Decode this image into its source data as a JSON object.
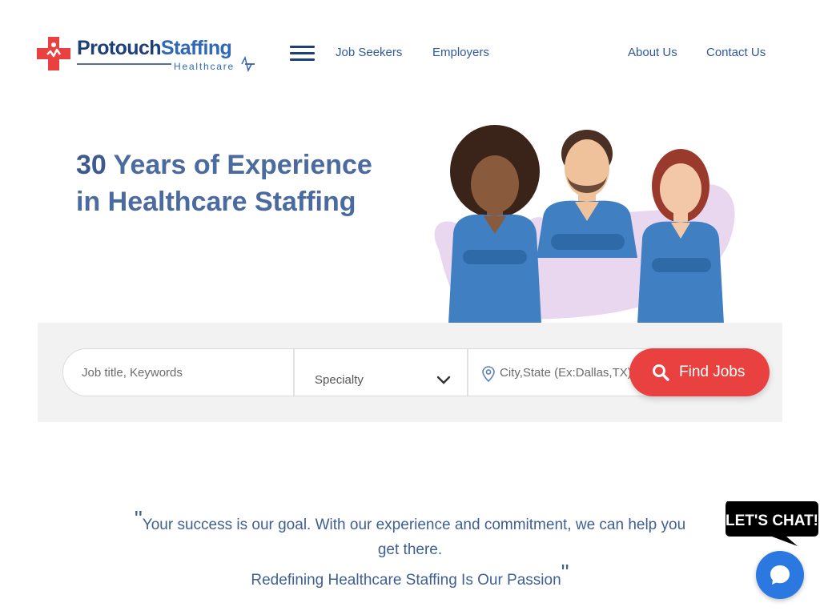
{
  "logo": {
    "word1": "Protouch",
    "word2": "Staffing",
    "subtitle": "Healthcare"
  },
  "nav": {
    "menu_icon": "hamburger-icon",
    "job_seekers": "Job Seekers",
    "employers": "Employers",
    "about_us": "About Us",
    "contact_us": "Contact Us"
  },
  "hero": {
    "number": "30",
    "title_rest": " Years of Experience in Healthcare Staffing"
  },
  "search": {
    "keywords_placeholder": "Job title, Keywords",
    "specialty_label": "Specialty",
    "location_placeholder": "City,State (Ex:Dallas,TX)",
    "find_label": "Find Jobs"
  },
  "quote": {
    "text": "Your success is our goal. With our experience and commitment, we can help you get there.",
    "tagline": "Redefining Healthcare Staffing Is Our Passion"
  },
  "chat": {
    "bubble_text": "LET'S CHAT!"
  },
  "colors": {
    "brand_red": "#e8413f",
    "brand_blue": "#1f3f7a",
    "chat_blue": "#2a78e0"
  }
}
